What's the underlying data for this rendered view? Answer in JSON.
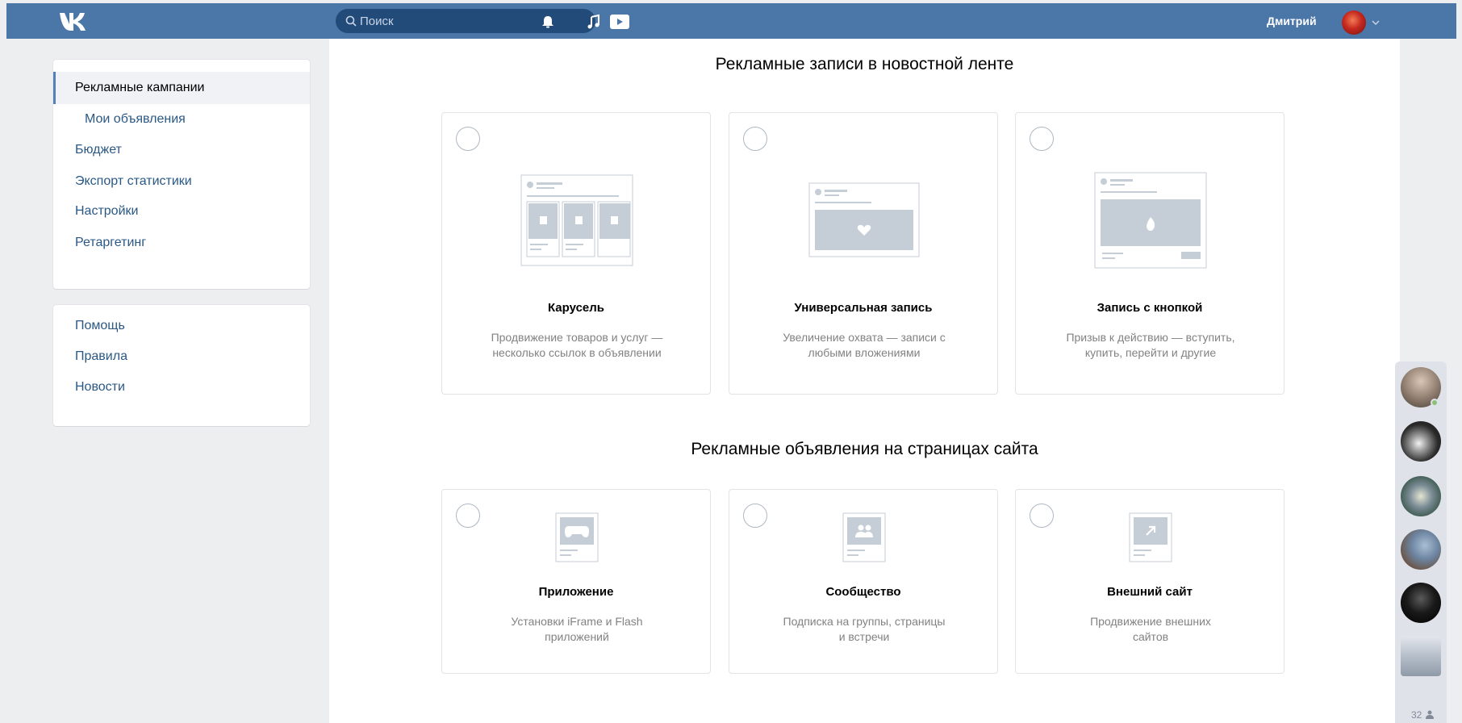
{
  "header": {
    "search_placeholder": "Поиск",
    "user_name": "Дмитрий"
  },
  "sidebar": {
    "main_items": [
      {
        "label": "Рекламные кампании",
        "active": true
      },
      {
        "label": "Мои объявления",
        "sub": true
      },
      {
        "label": "Бюджет"
      },
      {
        "label": "Экспорт статистики"
      },
      {
        "label": "Настройки"
      },
      {
        "label": "Ретаргетинг"
      }
    ],
    "help_items": [
      {
        "label": "Помощь"
      },
      {
        "label": "Правила"
      },
      {
        "label": "Новости"
      }
    ]
  },
  "sections": [
    {
      "title": "Рекламные записи в новостной ленте",
      "cards": [
        {
          "title": "Карусель",
          "desc_line1": "Продвижение товаров и услуг —",
          "desc_line2": "несколько ссылок в объявлении",
          "illustration": "carousel-illustration"
        },
        {
          "title": "Универсальная запись",
          "desc_line1": "Увеличение охвата — записи с",
          "desc_line2": "любыми вложениями",
          "illustration": "universal-post-illustration"
        },
        {
          "title": "Запись с кнопкой",
          "desc_line1": "Призыв к действию — вступить,",
          "desc_line2": "купить, перейти и другие",
          "illustration": "button-post-illustration"
        }
      ]
    },
    {
      "title": "Рекламные объявления на страницах сайта",
      "cards": [
        {
          "title": "Приложение",
          "desc_line1": "Установки iFrame и Flash",
          "desc_line2": "приложений",
          "illustration": "gamepad-icon"
        },
        {
          "title": "Сообщество",
          "desc_line1": "Подписка на группы, страницы",
          "desc_line2": "и встречи",
          "illustration": "community-icon"
        },
        {
          "title": "Внешний сайт",
          "desc_line1": "Продвижение внешних",
          "desc_line2": "сайтов",
          "illustration": "external-link-icon"
        }
      ]
    }
  ],
  "friends_panel": {
    "count": "32",
    "colors": {
      "accent": "#4a76a8",
      "online": "#8ac176"
    }
  }
}
